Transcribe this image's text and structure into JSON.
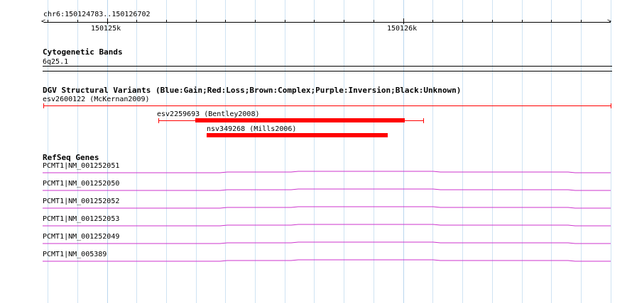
{
  "ruler": {
    "range_label": "chr6:150124783..150126702",
    "tick_labels": [
      "150125k",
      "150126k"
    ]
  },
  "cytoband": {
    "title": "Cytogenetic Bands",
    "band": "6q25.1"
  },
  "dgv": {
    "title": "DGV Structural Variants (Blue:Gain;Red:Loss;Brown:Complex;Purple:Inversion;Black:Unknown)",
    "variants": [
      {
        "label": "esv2600122 (McKernan2009)",
        "color": "#ff0000"
      },
      {
        "label": "esv2259693 (Bentley2008)",
        "color": "#ff0000"
      },
      {
        "label": "nsv349268 (Mills2006)",
        "color": "#ff0000"
      }
    ]
  },
  "refseq": {
    "title": "RefSeq Genes",
    "color": "#cc33cc",
    "genes": [
      {
        "label": "PCMT1|NM_001252051"
      },
      {
        "label": "PCMT1|NM_001252050"
      },
      {
        "label": "PCMT1|NM_001252052"
      },
      {
        "label": "PCMT1|NM_001252053"
      },
      {
        "label": "PCMT1|NM_001252049"
      },
      {
        "label": "PCMT1|NM_005389"
      }
    ]
  }
}
